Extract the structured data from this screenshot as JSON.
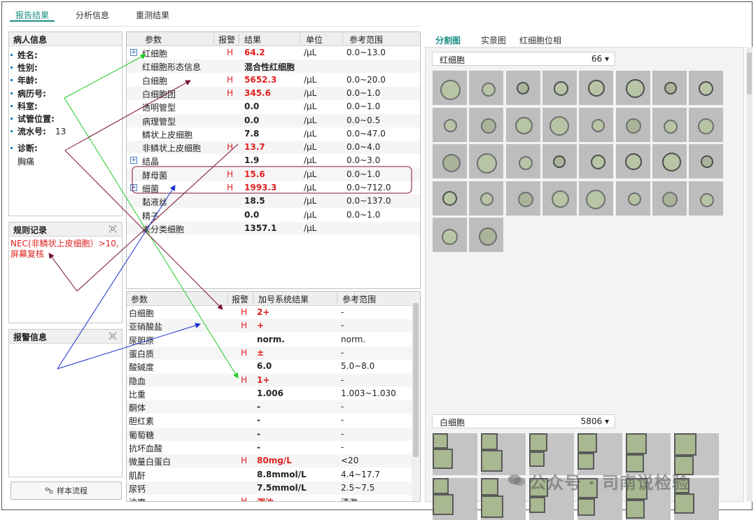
{
  "tabs": [
    "报告结果",
    "分析信息",
    "重测结果"
  ],
  "patient": {
    "title": "病人信息",
    "fields": [
      {
        "label": "姓名:",
        "value": ""
      },
      {
        "label": "性别:",
        "value": ""
      },
      {
        "label": "年龄:",
        "value": ""
      },
      {
        "label": "病历号:",
        "value": ""
      },
      {
        "label": "科室:",
        "value": ""
      },
      {
        "label": "试管位置:",
        "value": ""
      },
      {
        "label": "流水号:",
        "value": "13"
      }
    ],
    "diagnosis_label": "诊断:",
    "diagnosis_value": "胸痛"
  },
  "rules": {
    "title": "规则记录",
    "text": "NEC(非鳞状上皮细胞）>10,屏幕复核"
  },
  "alarm": {
    "title": "报警信息"
  },
  "flow_button": "样本流程",
  "sediment": {
    "headers": [
      "参数",
      "报警",
      "结果",
      "单位",
      "参考范围"
    ],
    "rows": [
      {
        "param": "红细胞",
        "flag": "H",
        "result": "64.2",
        "unit": "/μL",
        "range": "0.0~13.0",
        "expand": true,
        "red": true
      },
      {
        "param": "红细胞形态信息",
        "flag": "",
        "result": "混合性红细胞",
        "unit": "",
        "range": "",
        "expand": false,
        "red": false
      },
      {
        "param": "白细胞",
        "flag": "H",
        "result": "5652.3",
        "unit": "/μL",
        "range": "0.0~20.0",
        "expand": false,
        "red": true
      },
      {
        "param": "白细胞团",
        "flag": "H",
        "result": "345.6",
        "unit": "/μL",
        "range": "0.0~1.0",
        "expand": false,
        "red": true
      },
      {
        "param": "透明管型",
        "flag": "",
        "result": "0.0",
        "unit": "/μL",
        "range": "0.0~1.0",
        "expand": false,
        "red": false
      },
      {
        "param": "病理管型",
        "flag": "",
        "result": "0.0",
        "unit": "/μL",
        "range": "0.0~0.5",
        "expand": false,
        "red": false
      },
      {
        "param": "鳞状上皮细胞",
        "flag": "",
        "result": "7.8",
        "unit": "/μL",
        "range": "0.0~47.0",
        "expand": false,
        "red": false
      },
      {
        "param": "非鳞状上皮细胞",
        "flag": "H",
        "result": "13.7",
        "unit": "/μL",
        "range": "0.0~4.0",
        "expand": false,
        "red": true
      },
      {
        "param": "结晶",
        "flag": "",
        "result": "1.9",
        "unit": "/μL",
        "range": "0.0~3.0",
        "expand": true,
        "red": false
      },
      {
        "param": "酵母菌",
        "flag": "H",
        "result": "15.6",
        "unit": "/μL",
        "range": "0.0~1.0",
        "expand": false,
        "red": true
      },
      {
        "param": "细菌",
        "flag": "H",
        "result": "1993.3",
        "unit": "/μL",
        "range": "0.0~712.0",
        "expand": true,
        "red": true
      },
      {
        "param": "黏液丝",
        "flag": "",
        "result": "18.5",
        "unit": "/μL",
        "range": "0.0~137.0",
        "expand": false,
        "red": false
      },
      {
        "param": "精子",
        "flag": "",
        "result": "0.0",
        "unit": "/μL",
        "range": "0.0~1.0",
        "expand": false,
        "red": false
      },
      {
        "param": "未分类细胞",
        "flag": "",
        "result": "1357.1",
        "unit": "/μL",
        "range": "",
        "expand": false,
        "red": false
      }
    ]
  },
  "chemistry": {
    "headers": [
      "参数",
      "报警",
      "加号系统结果",
      "参考范围"
    ],
    "rows": [
      {
        "param": "白细胞",
        "flag": "H",
        "result": "2+",
        "range": "-",
        "red": true
      },
      {
        "param": "亚硝酸盐",
        "flag": "H",
        "result": "+",
        "range": "-",
        "red": true
      },
      {
        "param": "尿胆原",
        "flag": "",
        "result": "norm.",
        "range": "norm.",
        "red": false
      },
      {
        "param": "蛋白质",
        "flag": "H",
        "result": "±",
        "range": "-",
        "red": true
      },
      {
        "param": "酸碱度",
        "flag": "",
        "result": "6.0",
        "range": "5.0~8.0",
        "red": false
      },
      {
        "param": "隐血",
        "flag": "H",
        "result": "1+",
        "range": "-",
        "red": true
      },
      {
        "param": "比重",
        "flag": "",
        "result": "1.006",
        "range": "1.003~1.030",
        "red": false
      },
      {
        "param": "酮体",
        "flag": "",
        "result": "-",
        "range": "-",
        "red": false
      },
      {
        "param": "胆红素",
        "flag": "",
        "result": "-",
        "range": "-",
        "red": false
      },
      {
        "param": "葡萄糖",
        "flag": "",
        "result": "-",
        "range": "-",
        "red": false
      },
      {
        "param": "抗坏血酸",
        "flag": "",
        "result": "-",
        "range": "-",
        "red": false
      },
      {
        "param": "微量白蛋白",
        "flag": "H",
        "result": "80mg/L",
        "range": "<20",
        "red": true
      },
      {
        "param": "肌酐",
        "flag": "",
        "result": "8.8mmol/L",
        "range": "4.4~17.7",
        "red": false
      },
      {
        "param": "尿钙",
        "flag": "",
        "result": "7.5mmol/L",
        "range": "2.5~7.5",
        "red": false
      },
      {
        "param": "浊度",
        "flag": "H",
        "result": "浑浊",
        "range": "清澈",
        "red": true
      }
    ]
  },
  "image_tabs": [
    "分割图",
    "实景图",
    "红细胞位相"
  ],
  "rbc_category": {
    "name": "红细胞",
    "count": "66 ▾",
    "tiles": 34
  },
  "wbc_category": {
    "name": "白细胞",
    "count": "5806 ▾",
    "tiles": 12
  },
  "watermark": "公众号 · 司南说检验",
  "colors": {
    "accent": "#1a8f86",
    "alarm": "#e01f1f"
  }
}
